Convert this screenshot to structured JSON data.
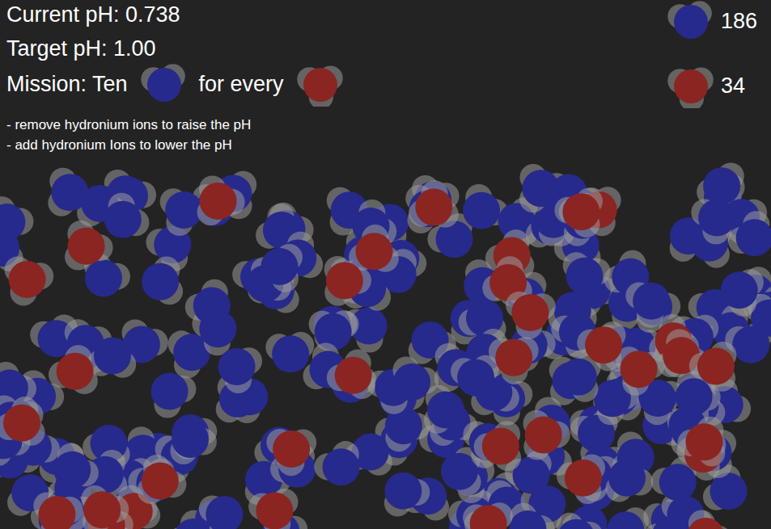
{
  "status": {
    "current_ph": "Current pH: 0.738",
    "target_ph": "Target pH: 1.00"
  },
  "mission": {
    "prefix": "Mission: Ten",
    "numerator": {
      "kind": "water",
      "color": "#262a8c"
    },
    "joiner": "for every",
    "denominator": {
      "kind": "hydronium",
      "color": "#8b2522"
    }
  },
  "hints": [
    "- remove hydronium ions to raise the pH",
    "- add hydronium Ions to lower the pH"
  ],
  "counters": [
    {
      "kind": "water",
      "count": "186",
      "color": "#262a8c"
    },
    {
      "kind": "hydronium",
      "count": "34",
      "color": "#8b2522"
    }
  ]
}
